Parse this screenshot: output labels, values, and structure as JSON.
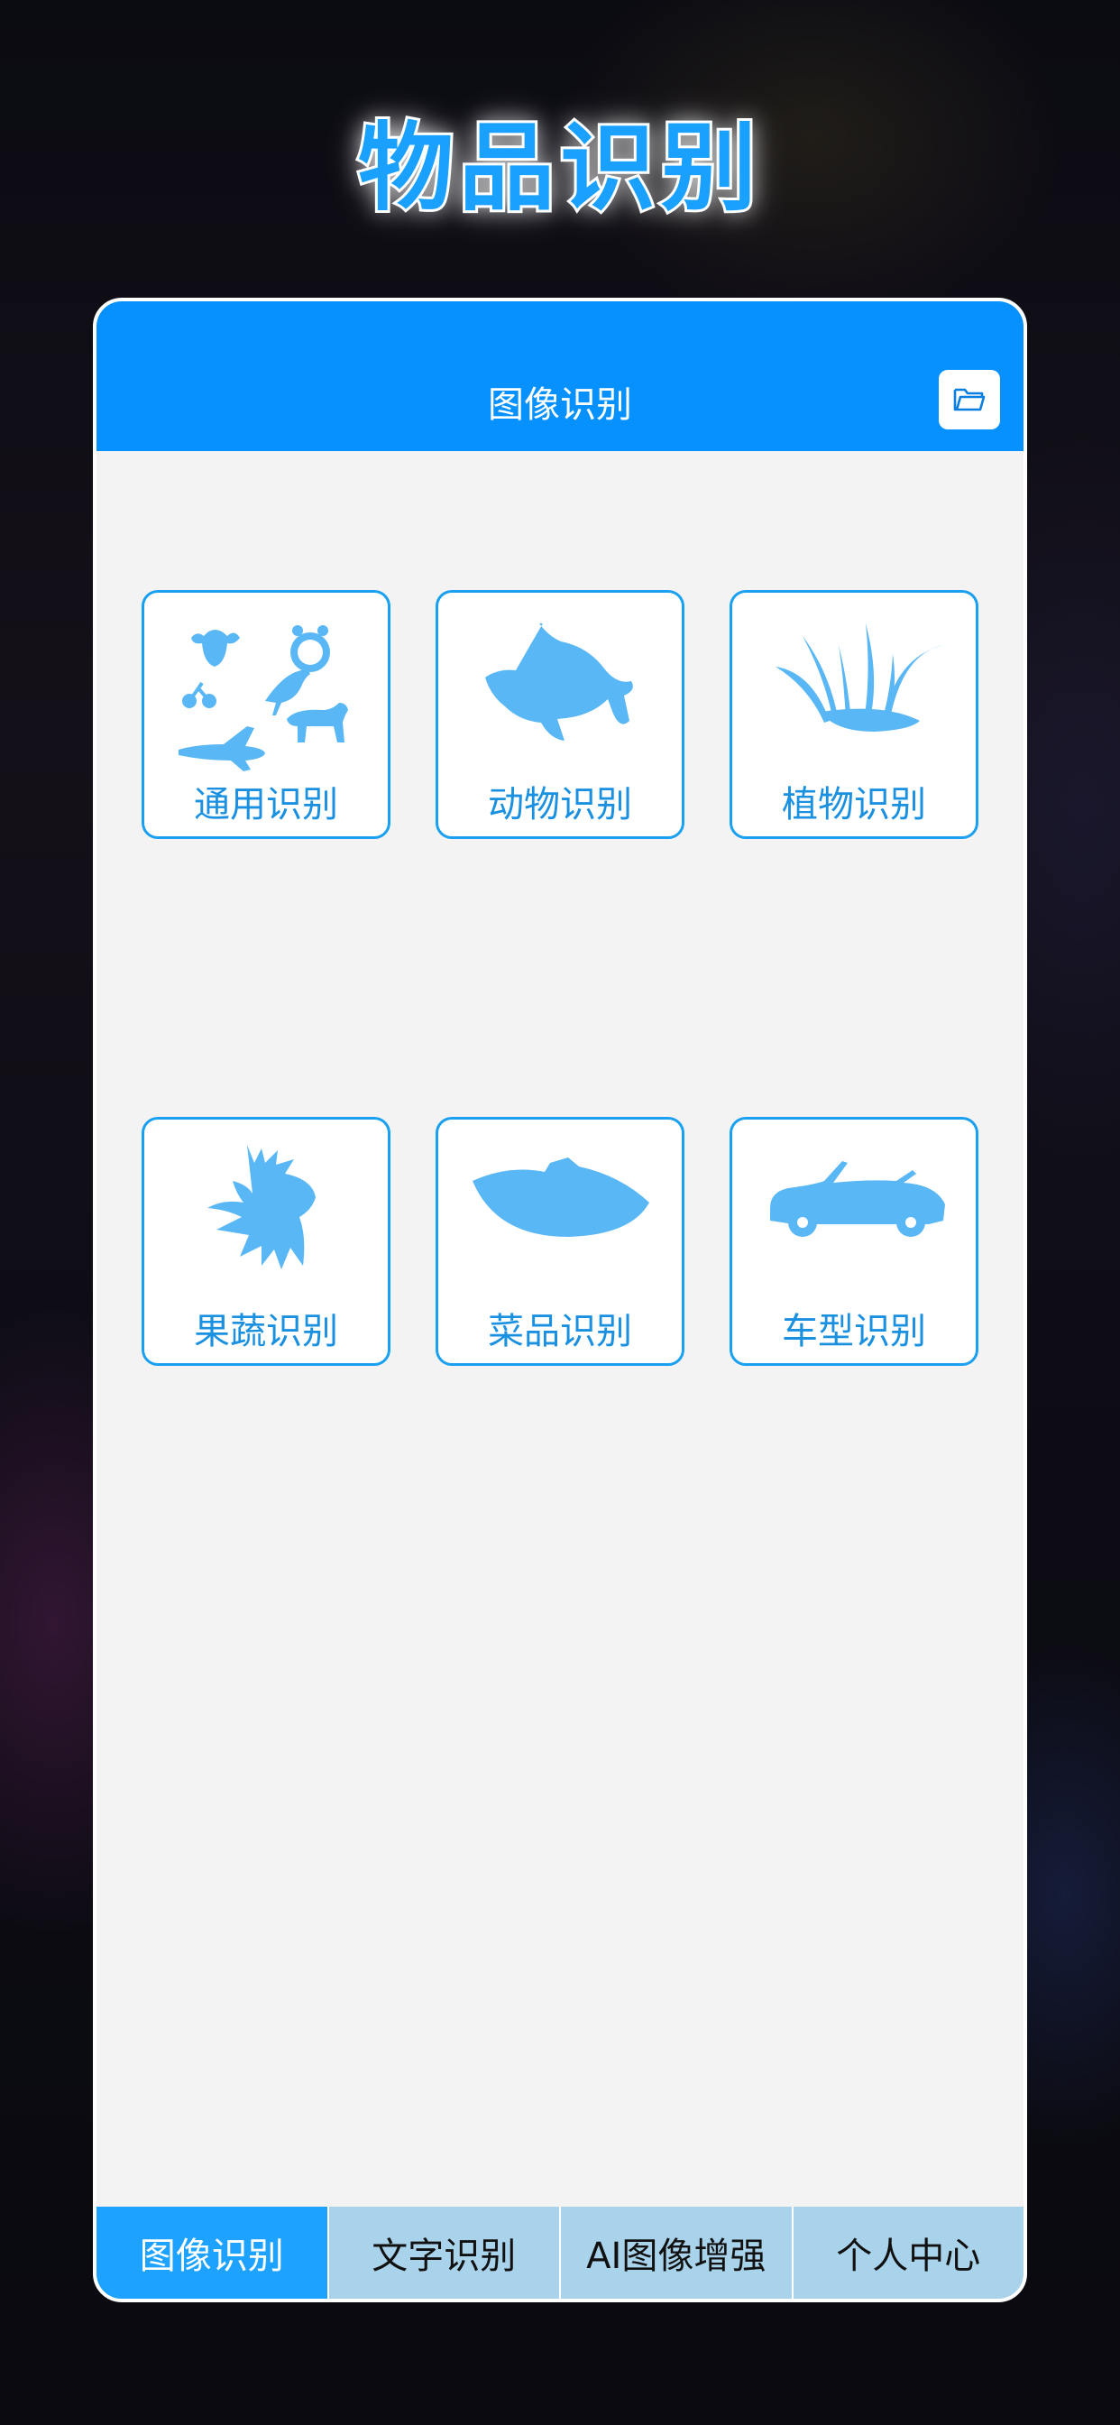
{
  "headline": "物品识别",
  "nav": {
    "title": "图像识别",
    "folder_icon": "folder-icon"
  },
  "categories": [
    {
      "label": "通用识别",
      "icon": "general-objects-icon"
    },
    {
      "label": "动物识别",
      "icon": "fish-icon"
    },
    {
      "label": "植物识别",
      "icon": "grass-icon"
    },
    {
      "label": "果蔬识别",
      "icon": "vegetable-icon"
    },
    {
      "label": "菜品识别",
      "icon": "dish-icon"
    },
    {
      "label": "车型识别",
      "icon": "car-icon"
    }
  ],
  "tabs": [
    {
      "label": "图像识别",
      "active": true
    },
    {
      "label": "文字识别",
      "active": false
    },
    {
      "label": "AI图像增强",
      "active": false
    },
    {
      "label": "个人中心",
      "active": false
    }
  ],
  "colors": {
    "accent": "#0691ff",
    "icon_fill": "#5ab7f5",
    "tab_inactive": "#a9d3ea"
  }
}
